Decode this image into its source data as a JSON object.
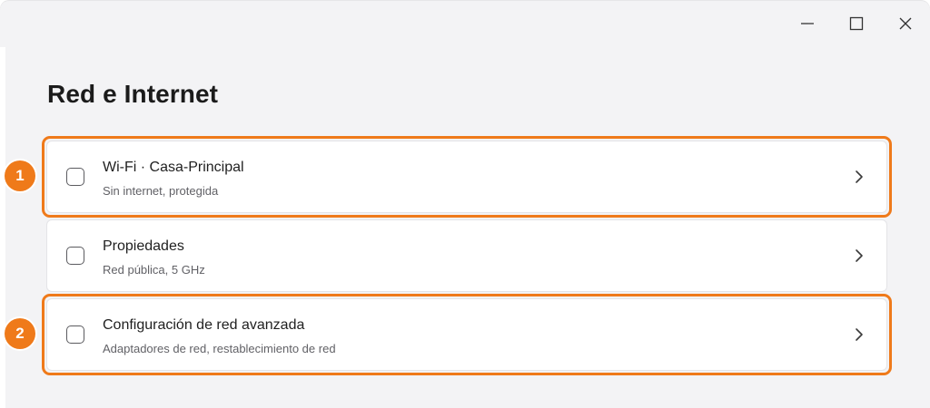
{
  "window": {
    "controls": {
      "minimize_icon": "minimize-icon",
      "maximize_icon": "maximize-icon",
      "close_icon": "close-icon"
    }
  },
  "page": {
    "title": "Red e Internet"
  },
  "items": [
    {
      "title": "Wi-Fi · Casa-Principal",
      "subtitle": "Sin internet, protegida",
      "highlighted": true,
      "badge": "1"
    },
    {
      "title": "Propiedades",
      "subtitle": "Red pública, 5 GHz",
      "highlighted": false
    },
    {
      "title": "Configuración de red avanzada",
      "subtitle": "Adaptadores de red, restablecimiento de red",
      "highlighted": true,
      "badge": "2"
    }
  ],
  "colors": {
    "highlight": "#ef7a1a",
    "window_bg": "#f3f3f5",
    "card_bg": "#ffffff"
  }
}
